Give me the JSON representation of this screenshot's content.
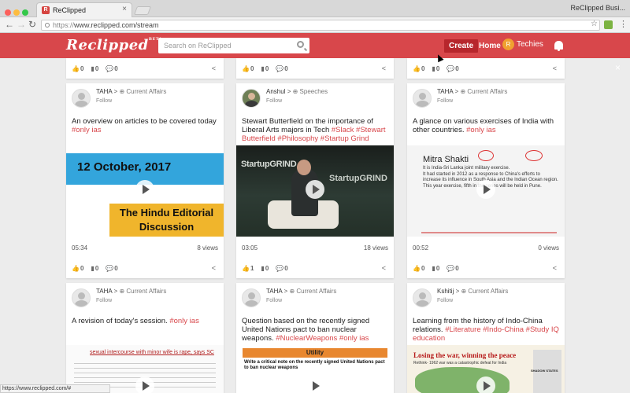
{
  "browser": {
    "tab_title": "ReClipped",
    "profile": "ReClipped Busi...",
    "url_scheme": "https://",
    "url_rest": "www.reclipped.com/stream",
    "status_url": "https://www.reclipped.com/#"
  },
  "header": {
    "logo": "Reclipped",
    "logo_sup": "BETA",
    "search_placeholder": "Search on ReClipped",
    "create": "Create",
    "home": "Home",
    "user_initial": "R",
    "user_name": "Techies"
  },
  "colors": {
    "brand": "#d8474b",
    "hashtag": "#d8474b"
  },
  "top_actions": [
    {
      "likes": "0",
      "saves": "0",
      "comments": "0"
    },
    {
      "likes": "0",
      "saves": "0",
      "comments": "0"
    },
    {
      "likes": "0",
      "saves": "0",
      "comments": "0"
    }
  ],
  "cards": [
    {
      "author": "TAHA",
      "category": "Current Affairs",
      "follow": "Follow",
      "title": "An overview on articles to be covered today",
      "tags": "#only ias",
      "thumb_date": "12 October, 2017",
      "thumb_title": "The Hindu Editorial Discussion",
      "duration": "05:34",
      "views": "8 views",
      "likes": "0",
      "saves": "0",
      "comments": "0"
    },
    {
      "author": "Anshul",
      "category": "Speeches",
      "follow": "Follow",
      "title": "Stewart Butterfield on the importance of Liberal Arts majors in Tech",
      "tags": "#Slack #Stewart Butterfield #Philosophy #Startup Grind",
      "thumb_text": "StartupGRIND",
      "duration": "03:05",
      "views": "18 views",
      "likes": "1",
      "saves": "0",
      "comments": "0"
    },
    {
      "author": "TAHA",
      "category": "Current Affairs",
      "follow": "Follow",
      "title": "A glance on various exercises of India with other countries.",
      "tags": "#only ias",
      "slide_title": "Mitra Shakti",
      "slide_lines": [
        "It is India-Sri Lanka joint military exercise.",
        "It had started in 2012 as a response to China's efforts to increase its influence in South Asia and the Indian Ocean region.",
        "This year exercise, fifth in the series will be held in Pune."
      ],
      "duration": "00:52",
      "views": "0 views",
      "likes": "0",
      "saves": "0",
      "comments": "0"
    },
    {
      "author": "TAHA",
      "category": "Current Affairs",
      "follow": "Follow",
      "title": "A revision of today's session.",
      "tags": "#only ias",
      "thumb_text": "sexual intercourse with minor wife is rape, says SC"
    },
    {
      "author": "TAHA",
      "category": "Current Affairs",
      "follow": "Follow",
      "title": "Question based on the recently signed United Nations pact to ban nuclear weapons.",
      "tags": "#NuclearWeapons #only ias",
      "thumb_header": "Utility",
      "thumb_text": "Write a critical note on the recently signed United Nations pact to ban nuclear weapons"
    },
    {
      "author": "Kshitij",
      "category": "Current Affairs",
      "follow": "Follow",
      "title": "Learning from the history of Indo-China relations.",
      "tags": "#Literature #Indo-China #Study IQ education",
      "thumb_text": "Losing the war, winning the peace",
      "thumb_sub": "Rethink- 1962 war was a catastrophic defeat for India",
      "thumb_side": "SHADOW STATES"
    }
  ]
}
